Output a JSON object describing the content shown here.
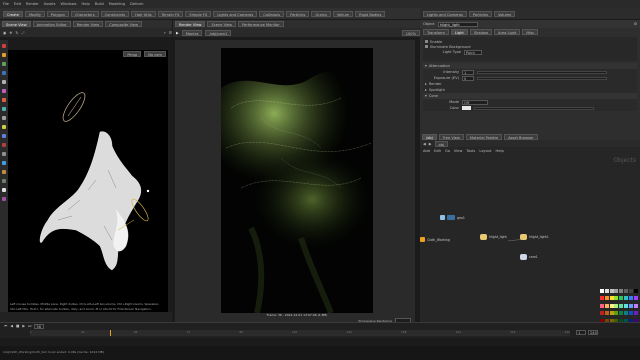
{
  "menubar": [
    "File",
    "Edit",
    "Render",
    "Assets",
    "Windows",
    "Help",
    "Build",
    "Modeling",
    "Deform",
    "Lights and Cameras",
    "Particles",
    "Volume"
  ],
  "shelf_tabs": [
    "Create",
    "Modify",
    "Polygon",
    "Characters",
    "Constraints",
    "Hair Utils",
    "Terrain FX",
    "Simple FX",
    "Lights and Cameras",
    "Collisions",
    "Particles",
    "Grains",
    "Vellum",
    "Rigid Bodies"
  ],
  "left_pane_tabs": [
    "Scene View",
    "Animation Editor",
    "Render View",
    "Composite View"
  ],
  "viewport": {
    "persp_label": "Persp",
    "cam_label": "No cam",
    "info_text": "Left mouse tumbles. Middle pans. Right dollies. Ctrl+Alt+Left box-zooms. Ctrl+Right zooms. Spacebar-Ctrl-Left tilts. Hold L for alternate tumble, dolly, and zoom. M or Alt+M for First Person Navigation."
  },
  "render_view": {
    "tabs": [
      "Render View",
      "Scene View",
      "Performance Monitor"
    ],
    "renderer": "Mantra",
    "camera": "/obj/cam1",
    "status": "Frame: 36 - 2021-12-01 13:07:06 (1.8M)",
    "progress_label": "Progressive Rendering",
    "zoom": "100%"
  },
  "params": {
    "node_type": "Object",
    "node_name": "hlight_light",
    "tabs": [
      "Transform",
      "Light",
      "Shadow",
      "Area Light",
      "Misc"
    ],
    "light_type_label": "Light Type",
    "light_type_value": "Point",
    "color_label": "Color",
    "intensity_label": "Intensity",
    "intensity_value": "1",
    "exposure_label": "Exposure (EV)",
    "exposure_value": "0",
    "sections": [
      "Attenuation",
      "Render",
      "Spotlight",
      "Cone"
    ],
    "enable_label": "Enable",
    "illuminate_label": "Illuminate Background",
    "mode_label": "Mode",
    "mode_value": "Off"
  },
  "network": {
    "tabs": [
      "/obj",
      "Tree View",
      "Material Palette",
      "Asset Browser"
    ],
    "path": "obj",
    "menu": [
      "Add",
      "Edit",
      "Go",
      "View",
      "Tools",
      "Layout",
      "Help"
    ],
    "context_label": "Objects",
    "nodes": [
      {
        "name": "geo1",
        "type": "geo"
      },
      {
        "name": "Cloth_Working",
        "type": "geo"
      },
      {
        "name": "hlight_light",
        "type": "light"
      },
      {
        "name": "hlight_light1",
        "type": "light"
      },
      {
        "name": "cam1",
        "type": "cam"
      }
    ]
  },
  "timeline": {
    "frame": "36",
    "start": "1",
    "end": "240",
    "ticks": [
      "1",
      "24",
      "48",
      "72",
      "96",
      "120",
      "144",
      "168",
      "192",
      "216",
      "240"
    ]
  },
  "status": {
    "text": "/obj/Cloth_Working/Cloth_Sim Cook ended: 0.08s (Cache: 1024 MB)"
  },
  "colors": {
    "accent": "#f0a020",
    "light_node": "#e8c870",
    "geo_node": "#3a6fa0",
    "render_green": "#7ea544"
  }
}
